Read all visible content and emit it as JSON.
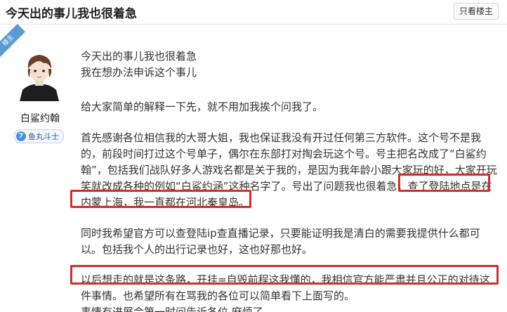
{
  "post": {
    "title": "今天出的事儿我也很着急",
    "only_op_label": "只看楼主"
  },
  "author": {
    "op_tag": "楼主",
    "name": "白鲨约翰",
    "badge_icon": "7",
    "badge_label": "鱼丸斗士"
  },
  "body": {
    "lines": [
      "今天出的事儿我也很着急",
      "我在想办法申诉这个事儿",
      "给大家简单的解释一下先，就不用加我挨个问我了。",
      "首先感谢各位相信我的大哥大姐，我也保证我没有开过任何第三方软件。这个号不是我",
      "的，前段时间打过这个号单子，偶尔在东部打对掏会玩这个号。号主把名改成了“白鲨约",
      "翰”，包括我们战队好多人游戏名都是关于我的，是因为我年龄小跟大家玩的好，大家开玩",
      "笑就改成各种的例如“白鲨约涵”这种名字了。号出了问题我也很着急，查了登陆地点是在",
      "内蒙上海，我一直都在河北秦皇岛。",
      "同时我希望官方可以查登陆ip查直播记录，只要能证明我是清白的需要我提供什么都可",
      "以。包括我个人的出行记录也好，这也好那也好。",
      "以后想走的就是这条路，开挂=自毁前程这我懂的，我相信官方能严肃并且公正的对待这",
      "件事情。也希望所有在骂我的各位可以简单看下上面写的。",
      "事情有进展会第一时间告诉各位 麻烦了。"
    ]
  },
  "colors": {
    "highlight_box": "#d62b2b",
    "badge_accent": "#4a8fe7",
    "op_ribbon": "#5b9bd5"
  }
}
